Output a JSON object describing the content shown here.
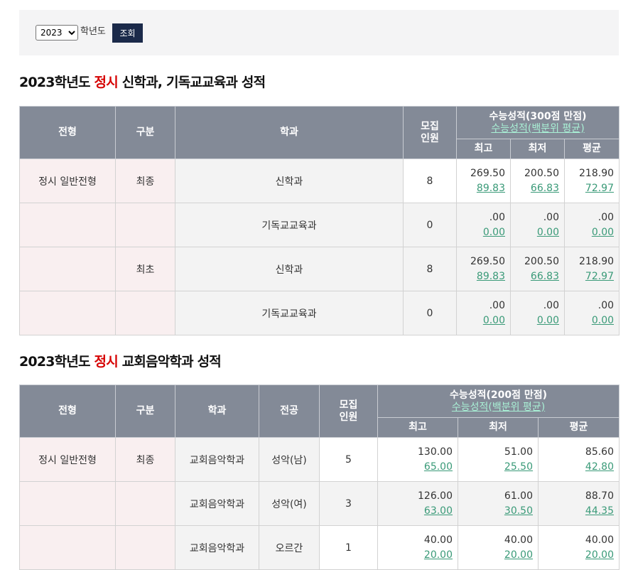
{
  "filter": {
    "year_selected": "2023",
    "year_options": [
      "2023"
    ],
    "year_suffix": "학년도",
    "search_button": "조회"
  },
  "section1": {
    "title_pre": "2023학년도 ",
    "title_red": "정시",
    "title_post": " 신학과, 기독교교육과 성적",
    "headers": {
      "type": "전형",
      "category": "구분",
      "dept": "학과",
      "quota": "모집\n인원",
      "score_title": "수능성적(300점 만점)",
      "score_sub": "수능성적(백분위 평균)",
      "max": "최고",
      "min": "최저",
      "avg": "평균"
    },
    "rows": [
      {
        "type": "정시 일반전형",
        "category": "최종",
        "dept": "신학과",
        "quota": "8",
        "max": "269.50",
        "max_pct": "89.83",
        "min": "200.50",
        "min_pct": "66.83",
        "avg": "218.90",
        "avg_pct": "72.97"
      },
      {
        "type": "",
        "category": "",
        "dept": "기독교교육과",
        "quota": "0",
        "max": ".00",
        "max_pct": "0.00",
        "min": ".00",
        "min_pct": "0.00",
        "avg": ".00",
        "avg_pct": "0.00"
      },
      {
        "type": "",
        "category": "최초",
        "dept": "신학과",
        "quota": "8",
        "max": "269.50",
        "max_pct": "89.83",
        "min": "200.50",
        "min_pct": "66.83",
        "avg": "218.90",
        "avg_pct": "72.97"
      },
      {
        "type": "",
        "category": "",
        "dept": "기독교교육과",
        "quota": "0",
        "max": ".00",
        "max_pct": "0.00",
        "min": ".00",
        "min_pct": "0.00",
        "avg": ".00",
        "avg_pct": "0.00"
      }
    ]
  },
  "section2": {
    "title_pre": "2023학년도 ",
    "title_red": "정시",
    "title_post": " 교회음악학과 성적",
    "headers": {
      "type": "전형",
      "category": "구분",
      "dept": "학과",
      "major": "전공",
      "quota": "모집\n인원",
      "score_title": "수능성적(200점 만점)",
      "score_sub": "수능성적(백분위 평균)",
      "max": "최고",
      "min": "최저",
      "avg": "평균"
    },
    "rows": [
      {
        "type": "정시 일반전형",
        "category": "최종",
        "dept": "교회음악학과",
        "major": "성악(남)",
        "quota": "5",
        "max": "130.00",
        "max_pct": "65.00",
        "min": "51.00",
        "min_pct": "25.50",
        "avg": "85.60",
        "avg_pct": "42.80"
      },
      {
        "type": "",
        "category": "",
        "dept": "교회음악학과",
        "major": "성악(여)",
        "quota": "3",
        "max": "126.00",
        "max_pct": "63.00",
        "min": "61.00",
        "min_pct": "30.50",
        "avg": "88.70",
        "avg_pct": "44.35"
      },
      {
        "type": "",
        "category": "",
        "dept": "교회음악학과",
        "major": "오르간",
        "quota": "1",
        "max": "40.00",
        "max_pct": "20.00",
        "min": "40.00",
        "min_pct": "20.00",
        "avg": "40.00",
        "avg_pct": "20.00"
      }
    ]
  }
}
